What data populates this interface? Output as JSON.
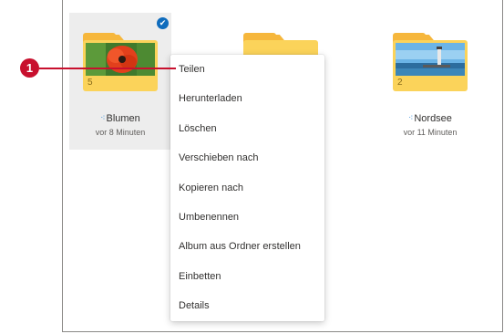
{
  "folders": [
    {
      "name": "Blumen",
      "modified": "vor 8 Minuten",
      "count": "5",
      "selected": true
    },
    {
      "name": "",
      "modified": "",
      "count": "",
      "selected": false
    },
    {
      "name": "Nordsee",
      "modified": "vor 11 Minuten",
      "count": "2",
      "selected": false
    }
  ],
  "context_menu": {
    "items": [
      "Teilen",
      "Herunterladen",
      "Löschen",
      "Verschieben nach",
      "Kopieren nach",
      "Umbenennen",
      "Album aus Ordner erstellen",
      "Einbetten",
      "Details"
    ]
  },
  "callout": {
    "number": "1",
    "color": "#c8102e"
  },
  "colors": {
    "accent": "#0f6cbd",
    "folder": "#fbd35a",
    "folder_tab": "#f6b73c"
  }
}
